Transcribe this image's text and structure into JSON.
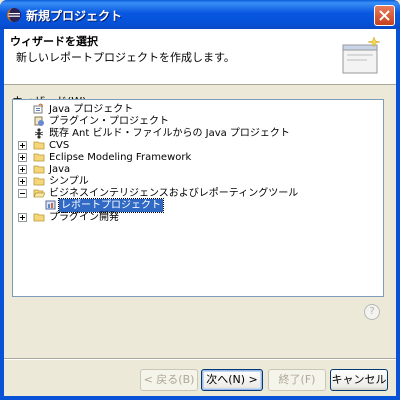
{
  "window": {
    "title": "新規プロジェクト"
  },
  "header": {
    "title": "ウィザードを選択",
    "description": "新しいレポートプロジェクトを作成します。"
  },
  "wizard_label": "ウィザード(W):",
  "tree": {
    "items": [
      {
        "label": "Java プロジェクト",
        "icon": "java-project-icon",
        "level": 0,
        "expander": "none"
      },
      {
        "label": "プラグイン・プロジェクト",
        "icon": "plugin-project-icon",
        "level": 0,
        "expander": "none"
      },
      {
        "label": "既存 Ant ビルド・ファイルからの Java プロジェクト",
        "icon": "ant-icon",
        "level": 0,
        "expander": "none"
      },
      {
        "label": "CVS",
        "icon": "folder-icon",
        "level": 0,
        "expander": "plus"
      },
      {
        "label": "Eclipse Modeling Framework",
        "icon": "folder-icon",
        "level": 0,
        "expander": "plus"
      },
      {
        "label": "Java",
        "icon": "folder-icon",
        "level": 0,
        "expander": "plus"
      },
      {
        "label": "シンプル",
        "icon": "folder-icon",
        "level": 0,
        "expander": "plus"
      },
      {
        "label": "ビジネスインテリジェンスおよびレポーティングツール",
        "icon": "folder-open-icon",
        "level": 0,
        "expander": "minus"
      },
      {
        "label": "レポートプロジェクト",
        "icon": "report-project-icon",
        "level": 1,
        "expander": "none",
        "selected": true
      },
      {
        "label": "プラグイン開発",
        "icon": "folder-icon",
        "level": 0,
        "expander": "plus"
      }
    ]
  },
  "buttons": {
    "back": "< 戻る(B)",
    "next": "次へ(N) >",
    "finish": "終了(F)",
    "cancel": "キャンセル"
  },
  "colors": {
    "selection": "#316ac5",
    "titlebar": "#0857e1"
  }
}
